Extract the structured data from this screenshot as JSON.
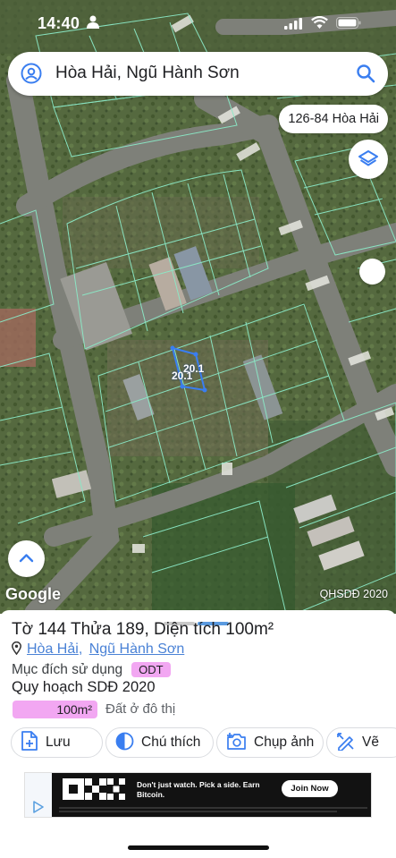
{
  "status_bar": {
    "time": "14:40"
  },
  "search": {
    "query": "Hòa Hải, Ngũ Hành Sơn"
  },
  "map": {
    "address_chip": "126-84 Hòa Hải",
    "parcel_labels": [
      "20.1",
      "20.1"
    ],
    "logo": "Google",
    "source": "QHSDĐ 2020"
  },
  "sheet": {
    "title_prefix": "Tờ",
    "sheet_no": "144",
    "parcel_word": "Thửa",
    "parcel_no": "189",
    "area_text": ", Diện tích 100m²",
    "ward": "Hòa Hải",
    "district": "Ngũ Hành Sơn",
    "purpose_label": "Mục đích sử dụng",
    "purpose_code": "ODT",
    "plan_title": "Quy hoạch SDĐ 2020",
    "plan_area": "100m²",
    "plan_land_use": "Đất ở đô thị",
    "actions": [
      "Lưu",
      "Chú thích",
      "Chụp ảnh",
      "Vẽ"
    ]
  },
  "ad": {
    "headline_1": "Don't just watch. Pick a side. Earn",
    "headline_2": "Bitcoin.",
    "cta": "Join Now"
  },
  "colors": {
    "parcel_line": "#8be8c6",
    "odt_pink": "#f2a7f2",
    "link_blue": "#4a82d6"
  }
}
